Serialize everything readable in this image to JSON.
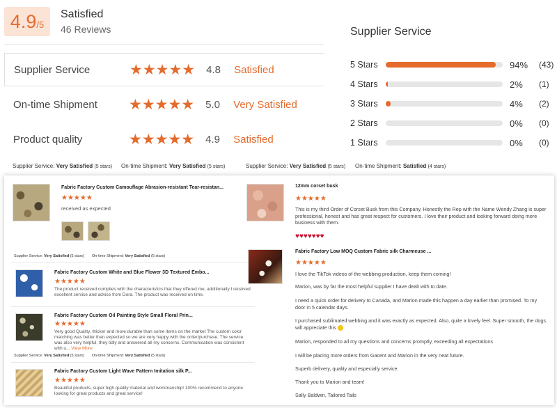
{
  "summary": {
    "score": "4.9",
    "score_denominator": "/5",
    "satisfaction": "Satisfied",
    "reviews_count": "46 Reviews"
  },
  "metrics": [
    {
      "name": "Supplier Service",
      "stars": "★★★★★",
      "value": "4.8",
      "sat": "Satisfied"
    },
    {
      "name": "On-time Shipment",
      "stars": "★★★★★",
      "value": "5.0",
      "sat": "Very Satisfied"
    },
    {
      "name": "Product quality",
      "stars": "★★★★★",
      "value": "4.9",
      "sat": "Satisfied"
    }
  ],
  "supplier_service": {
    "title": "Supplier Service",
    "rows": [
      {
        "label": "5 Stars",
        "pct": "94%",
        "count": "(43)",
        "fraction": 0.94
      },
      {
        "label": "4 Stars",
        "pct": "2%",
        "count": "(1)",
        "fraction": 0.02
      },
      {
        "label": "3 Stars",
        "pct": "4%",
        "count": "(2)",
        "fraction": 0.04
      },
      {
        "label": "2 Stars",
        "pct": "0%",
        "count": "(0)",
        "fraction": 0
      },
      {
        "label": "1 Stars",
        "pct": "0%",
        "count": "(0)",
        "fraction": 0
      }
    ]
  },
  "summary_tags": [
    {
      "label": "Supplier Service:",
      "value": "Very Satisfied",
      "count": "(5 stars)"
    },
    {
      "label": "On-time Shipment:",
      "value": "Very Satisfied",
      "count": "(5 stars)"
    },
    {
      "label": "Supplier Service:",
      "value": "Very Satisfied",
      "count": "(5 stars)"
    },
    {
      "label": "On-time Shipment:",
      "value": "Satisfied",
      "count": "(4 stars)"
    }
  ],
  "reviews_left": [
    {
      "title": "Fabric Factory Custom Camouflage Abrasion-resistant Tear-resistan...",
      "stars": "★★★★★",
      "text": "received as expected",
      "tag1_label": "Supplier Service:",
      "tag1_value": "Very Satisfied",
      "tag1_count": "(5 stars)",
      "tag2_label": "On-time Shipment:",
      "tag2_value": "Very Satisfied",
      "tag2_count": "(5 stars)"
    },
    {
      "title": "Fabric Factory Custom White and Blue Flower 3D Textured Embo...",
      "stars": "★★★★★",
      "text": "The product received complies with the characteristics that they offered me, additionally I received excellent service and advice from Dora. The product was received on time."
    },
    {
      "title": "Fabric Factory Custom Oil Painting Style Small Floral Prin...",
      "stars": "★★★★★",
      "text": "Very good Quality, thicker and more durable than some items on the market The custom color matching was better than expected so we are very happy with the order/purchase. The service was also very helpful, they tidly and answered all my concerns. Communication was consistent with u...",
      "view_more": "View More",
      "tag1_label": "Supplier Service:",
      "tag1_value": "Very Satisfied",
      "tag1_count": "(5 stars)",
      "tag2_label": "On-time Shipment:",
      "tag2_value": "Very Satisfied",
      "tag2_count": "(5 stars)"
    },
    {
      "title": "Fabric Factory Custom Light Wave Pattern Imitation silk P...",
      "stars": "★★★★★",
      "text": "Beautiful products, super high quality material and workmanship! 100% recommend to anyone looking for great products and great service!"
    }
  ],
  "reviews_right": [
    {
      "title": "12mm corset busk",
      "stars": "★★★★★",
      "text": "This is my third Order of Corset Busk from this Company. Honestly the Rep with the Name Wendy Zhang is super professional, honest and has great respect for customers. I love their product and looking forward doing more business with them.",
      "hearts": "♥♥♥♥♥♥♥"
    },
    {
      "title": "Fabric Factory Low MOQ Custom Fabric silk Charmeuse ...",
      "stars": "★★★★★",
      "lines": [
        "I love the TikTok videos of the webbing production, keep them coming!",
        "Marion, was by far the most helpful supplier I have dealt with to date.",
        "I need a quick order for delivery to Canada, and Marion made this happen a day earlier than promised.  To my door in 5 calendar days.",
        "I purchased sublimated webbing and it was exactly as expected. Also, quite a lovely feel.  Super smooth, the dogs will appreciate this",
        "Marion, responded to all my questions and concerns promptly, exceeding all expectations",
        "I will be placing more orders from Gacent and Marion in the very neat future.",
        "Superb delivery, quality and especially service.",
        "Thank you to Marion and team!",
        "Sally Baldwin, Tailored Tails"
      ]
    }
  ],
  "colors": {
    "accent": "#e46b2c",
    "score_bg": "#fbe3d6",
    "bar_track": "#e6e6e6"
  },
  "icons": {
    "star": "star-icon",
    "heart": "heart-icon",
    "emoji": "smile-emoji-icon"
  }
}
